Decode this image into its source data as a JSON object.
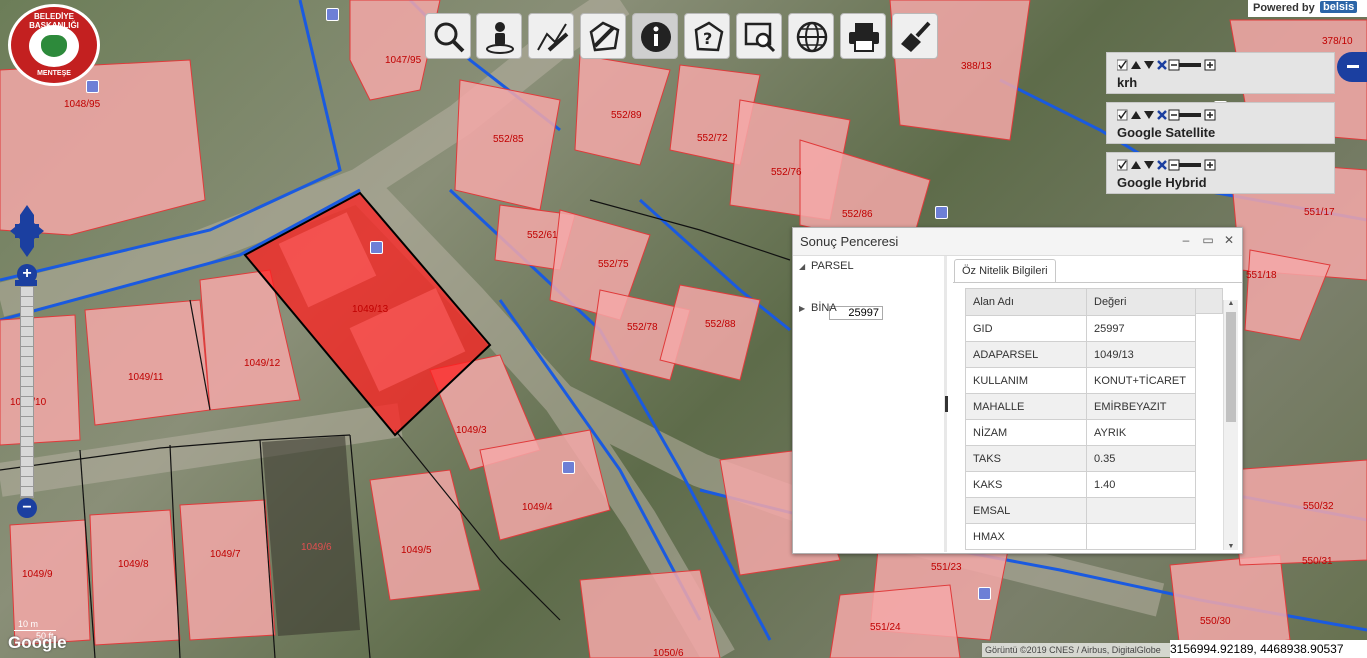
{
  "logo": {
    "line1": "BELEDİYE BAŞKANLIĞI",
    "line2": "MENTEŞE",
    "icon": "municipality-logo"
  },
  "toolbar": {
    "icons": [
      "search-icon",
      "user-location-icon",
      "measure-icon",
      "area-measure-icon",
      "info-icon",
      "query-icon",
      "search-results-icon",
      "globe-icon",
      "print-icon",
      "clear-icon"
    ]
  },
  "powered": {
    "text": "Powered by",
    "brand": "belsis"
  },
  "layers": [
    {
      "name": "krh"
    },
    {
      "name": "Google Satellite"
    },
    {
      "name": "Google Hybrid"
    }
  ],
  "parcels": [
    "1048/95",
    "1047/95",
    "552/85",
    "552/89",
    "552/72",
    "388/13",
    "378/10",
    "552/76",
    "552/86",
    "551/17",
    "552/61",
    "552/75",
    "552/78",
    "552/88",
    "551/18",
    "1049/11",
    "1049/12",
    "1049/10",
    "1049/13",
    "1049/3",
    "1049/4",
    "1049/5",
    "1049/6",
    "1049/7",
    "1049/8",
    "1049/9",
    "551/23",
    "551/24",
    "550/30",
    "550/31",
    "550/32",
    "1050/6"
  ],
  "scale": {
    "metric": "10 m",
    "imperial": "50 ft"
  },
  "google": "Google",
  "attribution": "Görüntü ©2019 CNES / Airbus, DigitalGlobe",
  "coordinates": "3156994.92189, 4468938.90537",
  "result_window": {
    "title": "Sonuç Penceresi",
    "tree": {
      "node1": "PARSEL",
      "node1_value": "25997",
      "node2": "BİNA"
    },
    "tab": "Öz Nitelik Bilgileri",
    "columns": [
      "Alan Adı",
      "Değeri"
    ],
    "rows": [
      [
        "GID",
        "25997"
      ],
      [
        "ADAPARSEL",
        "1049/13"
      ],
      [
        "KULLANIM",
        "KONUT+TİCARET"
      ],
      [
        "MAHALLE",
        "EMİRBEYAZIT"
      ],
      [
        "NİZAM",
        "AYRIK"
      ],
      [
        "TAKS",
        "0.35"
      ],
      [
        "KAKS",
        "1.40"
      ],
      [
        "EMSAL",
        ""
      ],
      [
        "HMAX",
        ""
      ]
    ]
  },
  "colors": {
    "parcel_fill": "#f4a8a8",
    "selected": "#ff0000",
    "road_line": "#1a5ae0",
    "nav_blue": "#1b3fa0"
  }
}
